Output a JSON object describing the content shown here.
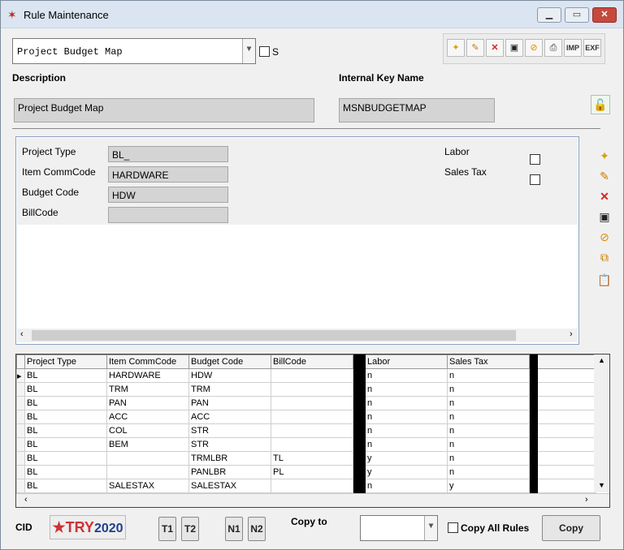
{
  "window": {
    "title": "Rule Maintenance"
  },
  "rule_select": {
    "value": "Project Budget Map",
    "s_label": "S"
  },
  "toolbar": {
    "imp_label": "IMP",
    "exp_label": "EXF"
  },
  "description": {
    "label": "Description",
    "value": "Project Budget Map"
  },
  "internal_key": {
    "label": "Internal Key Name",
    "value": "MSNBUDGETMAP"
  },
  "detail": {
    "project_type_label": "Project Type",
    "project_type_value": "BL_",
    "item_commcode_label": "Item CommCode",
    "item_commcode_value": "HARDWARE",
    "budget_code_label": "Budget Code",
    "budget_code_value": "HDW",
    "billcode_label": "BillCode",
    "billcode_value": "",
    "labor_label": "Labor",
    "sales_tax_label": "Sales Tax"
  },
  "grid": {
    "columns": [
      "Project Type",
      "Item CommCode",
      "Budget Code",
      "BillCode",
      "Labor",
      "Sales Tax"
    ],
    "rows": [
      [
        "BL",
        "HARDWARE",
        "HDW",
        "",
        "n",
        "n"
      ],
      [
        "BL",
        "TRM",
        "TRM",
        "",
        "n",
        "n"
      ],
      [
        "BL",
        "PAN",
        "PAN",
        "",
        "n",
        "n"
      ],
      [
        "BL",
        "ACC",
        "ACC",
        "",
        "n",
        "n"
      ],
      [
        "BL",
        "COL",
        "STR",
        "",
        "n",
        "n"
      ],
      [
        "BL",
        "BEM",
        "STR",
        "",
        "n",
        "n"
      ],
      [
        "BL",
        "",
        "TRMLBR",
        "TL",
        "y",
        "n"
      ],
      [
        "BL",
        "",
        "PANLBR",
        "PL",
        "y",
        "n"
      ],
      [
        "BL",
        "SALESTAX",
        "SALESTAX",
        "",
        "n",
        "y"
      ]
    ]
  },
  "footer": {
    "cid_label": "CID",
    "logo_text_a": "TRY",
    "logo_text_b": "20",
    "logo_text_c": "20",
    "t1": "T1",
    "t2": "T2",
    "n1": "N1",
    "n2": "N2",
    "copy_to_label": "Copy to",
    "copy_all_rules_label": "Copy All Rules",
    "copy_button": "Copy"
  }
}
